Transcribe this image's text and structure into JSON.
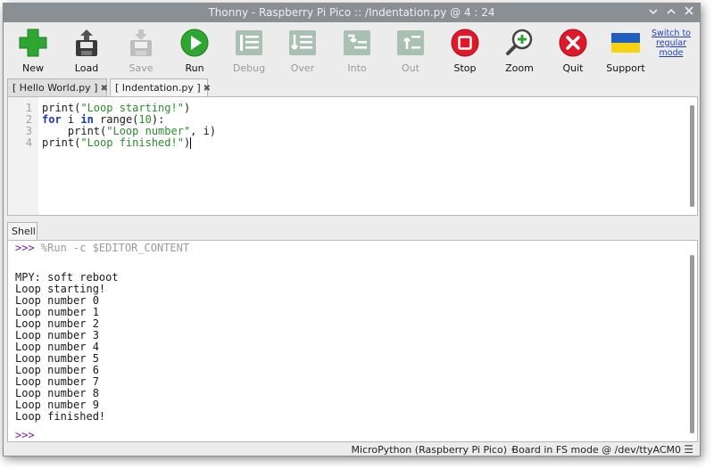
{
  "window": {
    "title": "Thonny  -  Raspberry Pi Pico :: /Indentation.py  @  4 : 24",
    "controls": [
      "chevron-down-icon",
      "chevron-up-icon",
      "close-icon"
    ]
  },
  "toolbar": {
    "buttons": [
      {
        "label": "New",
        "icon": "new-icon",
        "enabled": true
      },
      {
        "label": "Load",
        "icon": "load-icon",
        "enabled": true
      },
      {
        "label": "Save",
        "icon": "save-icon",
        "enabled": false
      },
      {
        "label": "Run",
        "icon": "run-icon",
        "enabled": true
      },
      {
        "label": "Debug",
        "icon": "debug-icon",
        "enabled": false
      },
      {
        "label": "Over",
        "icon": "step-over-icon",
        "enabled": false
      },
      {
        "label": "Into",
        "icon": "step-into-icon",
        "enabled": false
      },
      {
        "label": "Out",
        "icon": "step-out-icon",
        "enabled": false
      },
      {
        "label": "Stop",
        "icon": "stop-icon",
        "enabled": true
      },
      {
        "label": "Zoom",
        "icon": "zoom-icon",
        "enabled": true
      },
      {
        "label": "Quit",
        "icon": "quit-icon",
        "enabled": true
      },
      {
        "label": "Support",
        "icon": "ukraine-flag-icon",
        "enabled": true
      }
    ],
    "switch_mode": "Switch to regular mode",
    "colors": {
      "green": "#2fa632",
      "red": "#e0192a",
      "disabled": "#a9c1b3",
      "flag_blue": "#1e5fc0",
      "flag_yellow": "#f6d20f"
    }
  },
  "editor": {
    "tabs": [
      {
        "label": "[ Hello World.py ]",
        "active": false
      },
      {
        "label": "[ Indentation.py ]",
        "active": true
      }
    ],
    "line_numbers": [
      "1",
      "2",
      "3",
      "4"
    ],
    "code_lines": [
      [
        {
          "t": "print(",
          "c": ""
        },
        {
          "t": "\"Loop starting!\"",
          "c": "str"
        },
        {
          "t": ")",
          "c": ""
        }
      ],
      [
        {
          "t": "for",
          "c": "kw"
        },
        {
          "t": " i ",
          "c": ""
        },
        {
          "t": "in",
          "c": "kw"
        },
        {
          "t": " range(",
          "c": ""
        },
        {
          "t": "10",
          "c": "num"
        },
        {
          "t": "):",
          "c": ""
        }
      ],
      [
        {
          "t": "    print(",
          "c": ""
        },
        {
          "t": "\"Loop number\"",
          "c": "str"
        },
        {
          "t": ", i)",
          "c": ""
        }
      ],
      [
        {
          "t": "print(",
          "c": ""
        },
        {
          "t": "\"Loop finished!\"",
          "c": "str"
        },
        {
          "t": ")",
          "c": ""
        }
      ]
    ]
  },
  "shell": {
    "tab_label": "Shell",
    "prompt": ">>>",
    "command": " %Run -c $EDITOR_CONTENT",
    "output": [
      "MPY: soft reboot",
      "Loop starting!",
      "Loop number 0",
      "Loop number 1",
      "Loop number 2",
      "Loop number 3",
      "Loop number 4",
      "Loop number 5",
      "Loop number 6",
      "Loop number 7",
      "Loop number 8",
      "Loop number 9",
      "Loop finished!"
    ],
    "final_prompt": ">>>"
  },
  "statusbar": {
    "interpreter": "MicroPython (Raspberry Pi Pico)",
    "separator": "•",
    "device": "Board in FS mode @ /dev/ttyACM0",
    "menu_icon": "hamburger-menu-icon"
  }
}
